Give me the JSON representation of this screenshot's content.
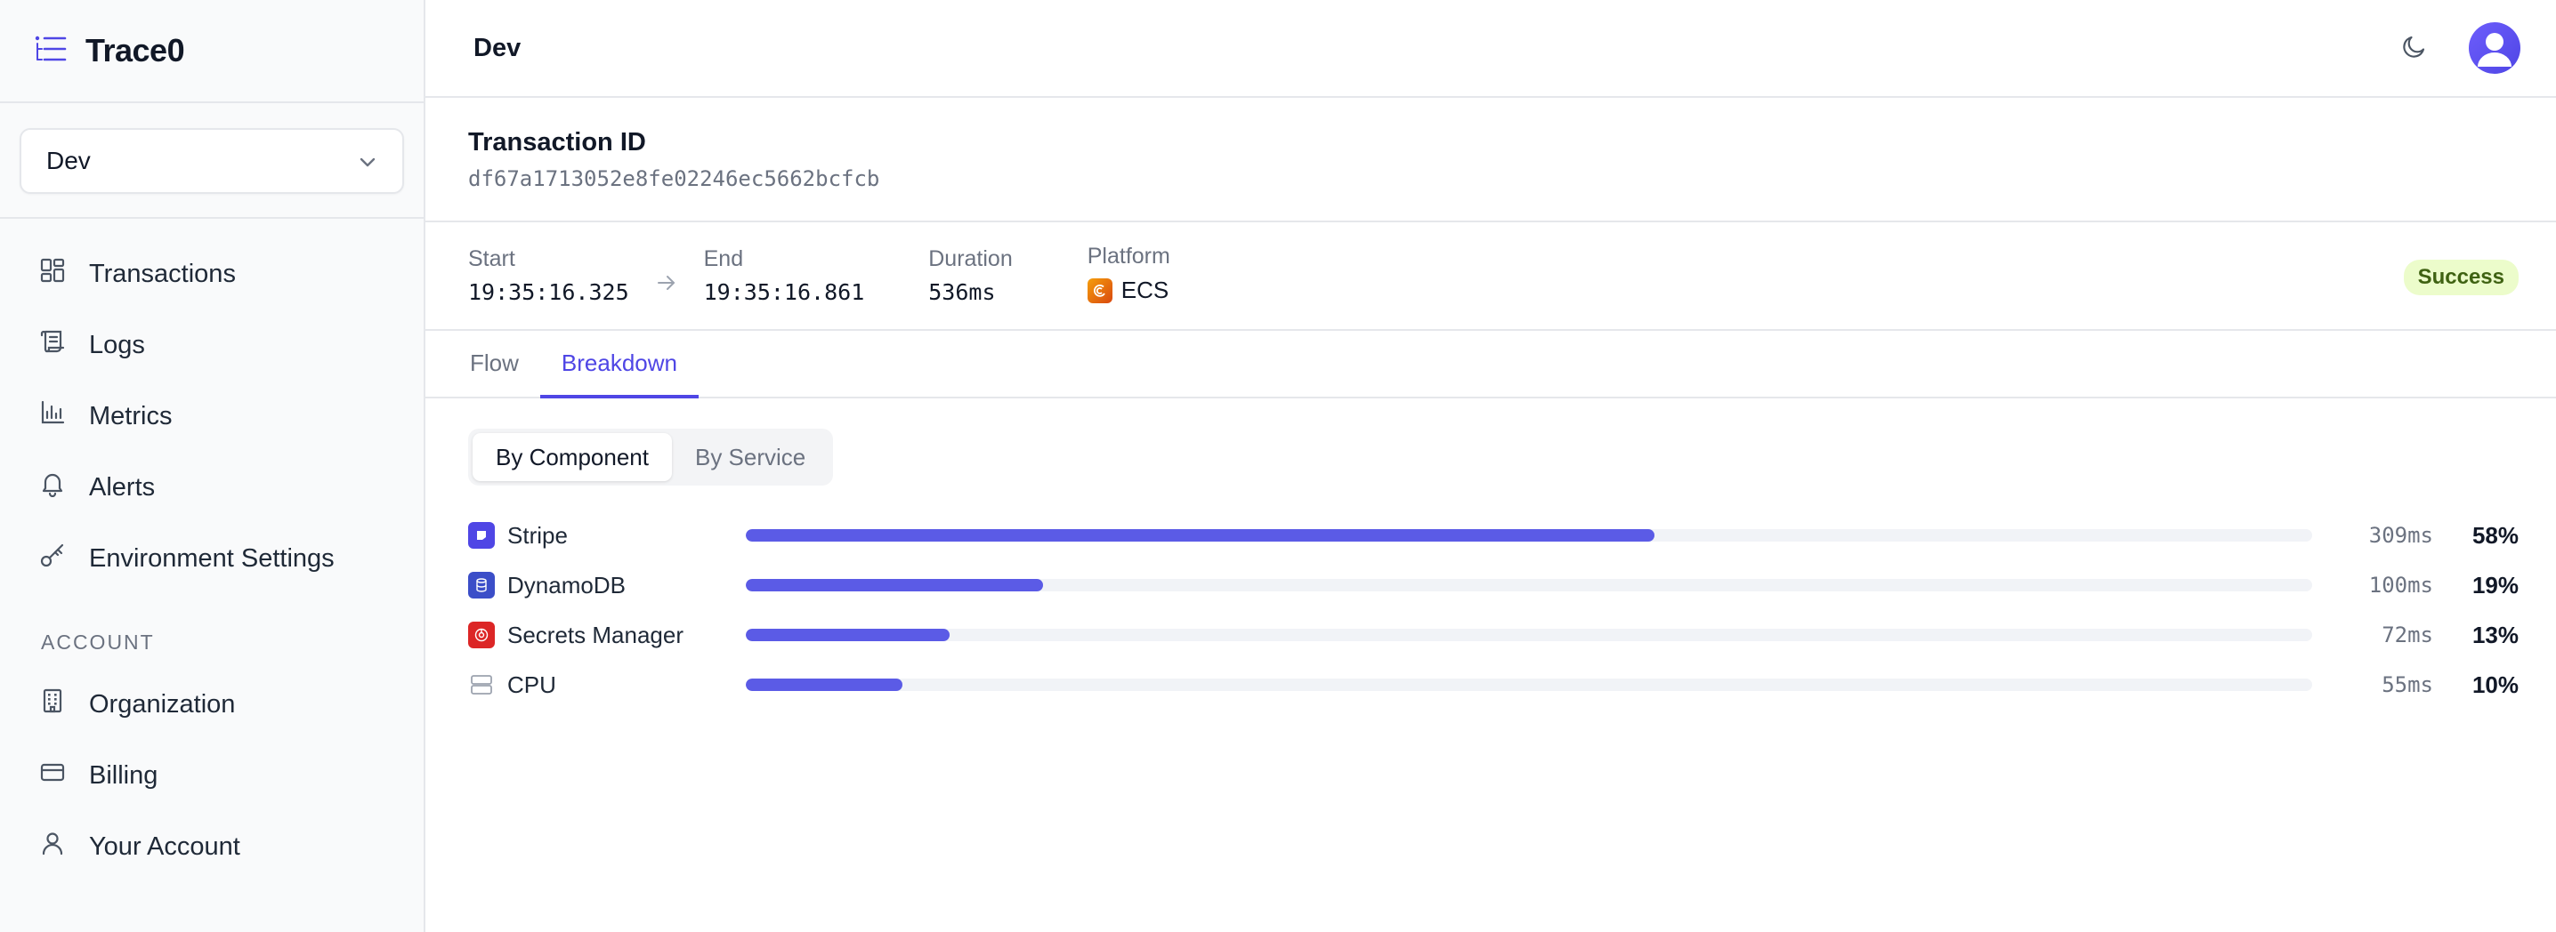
{
  "app": {
    "name": "Trace0"
  },
  "sidebar": {
    "environment": "Dev",
    "nav": [
      {
        "label": "Transactions",
        "icon": "grid-icon"
      },
      {
        "label": "Logs",
        "icon": "scroll-icon"
      },
      {
        "label": "Metrics",
        "icon": "bar-chart-icon"
      },
      {
        "label": "Alerts",
        "icon": "bell-icon"
      },
      {
        "label": "Environment Settings",
        "icon": "key-icon"
      }
    ],
    "account_label": "ACCOUNT",
    "account": [
      {
        "label": "Organization",
        "icon": "building-icon"
      },
      {
        "label": "Billing",
        "icon": "credit-card-icon"
      },
      {
        "label": "Your Account",
        "icon": "user-icon"
      }
    ]
  },
  "header": {
    "title": "Dev"
  },
  "transaction": {
    "label": "Transaction ID",
    "id": "df67a1713052e8fe02246ec5662bcfcb",
    "start_label": "Start",
    "start": "19:35:16.325",
    "end_label": "End",
    "end": "19:35:16.861",
    "duration_label": "Duration",
    "duration": "536ms",
    "platform_label": "Platform",
    "platform": "ECS",
    "status": "Success"
  },
  "tabs": [
    {
      "label": "Flow",
      "active": false
    },
    {
      "label": "Breakdown",
      "active": true
    }
  ],
  "breakdown": {
    "toggle": [
      {
        "label": "By Component",
        "active": true
      },
      {
        "label": "By Service",
        "active": false
      }
    ],
    "rows": [
      {
        "name": "Stripe",
        "ms": "309ms",
        "pct": "58%",
        "fraction": 0.58,
        "icon": "stripe-icon",
        "color": "#4f46e5"
      },
      {
        "name": "DynamoDB",
        "ms": "100ms",
        "pct": "19%",
        "fraction": 0.19,
        "icon": "dynamodb-icon",
        "color": "#3b4ec8"
      },
      {
        "name": "Secrets Manager",
        "ms": "72ms",
        "pct": "13%",
        "fraction": 0.13,
        "icon": "secrets-manager-icon",
        "color": "#dc2626"
      },
      {
        "name": "CPU",
        "ms": "55ms",
        "pct": "10%",
        "fraction": 0.1,
        "icon": "server-icon",
        "color": "#9ca3af"
      }
    ]
  },
  "colors": {
    "accent": "#4f46e5",
    "bar": "#5b5be6",
    "success_bg": "#ecfccb",
    "success_text": "#3f6212"
  }
}
